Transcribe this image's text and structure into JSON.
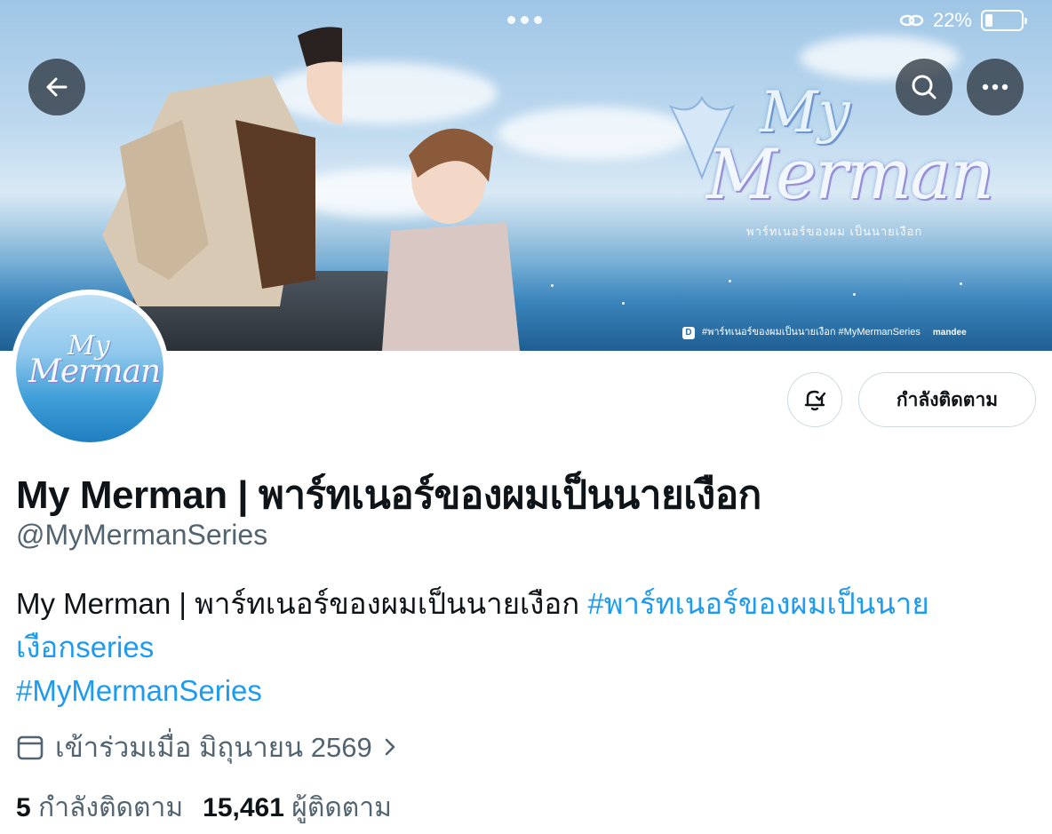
{
  "status_bar": {
    "battery_text": "22%",
    "battery_level": 0.22,
    "link_icon": "link-icon"
  },
  "banner": {
    "logo_my": "My",
    "logo_merman": "Merman",
    "logo_thai_sub": "พาร์ทเนอร์ของผม เป็นนายเงือก",
    "footer_hashtags": "#พาร์ทเนอร์ของผมเป็นนายเงือก  #MyMermanSeries",
    "footer_badge": "D",
    "footer_brand": "mandee"
  },
  "nav": {
    "back_icon": "arrow-left-icon",
    "search_icon": "search-icon",
    "more_icon": "more-horizontal-icon"
  },
  "profile": {
    "avatar_my": "My",
    "avatar_merman": "Merman",
    "display_name": "My Merman | พาร์ทเนอร์ของผมเป็นนายเงือก",
    "handle": "@MyMermanSeries",
    "bio_text": "My Merman | พาร์ทเนอร์ของผมเป็นนายเงือก ",
    "bio_hashtag_1": "#พาร์ทเนอร์ของผมเป็นนายเงือกseries",
    "bio_hashtag_2": "#MyMermanSeries",
    "joined": "เข้าร่วมเมื่อ มิถุนายน 2569",
    "following_count": "5",
    "following_label": "กำลังติดตาม",
    "followers_count": "15,461",
    "followers_label": "ผู้ติดตาม"
  },
  "actions": {
    "follow_state_label": "กำลังติดตาม",
    "notify_icon": "bell-check-icon"
  },
  "colors": {
    "accent": "#1d9bf0",
    "text_primary": "#0f1419",
    "text_secondary": "#536471",
    "border": "#cfd9de"
  }
}
